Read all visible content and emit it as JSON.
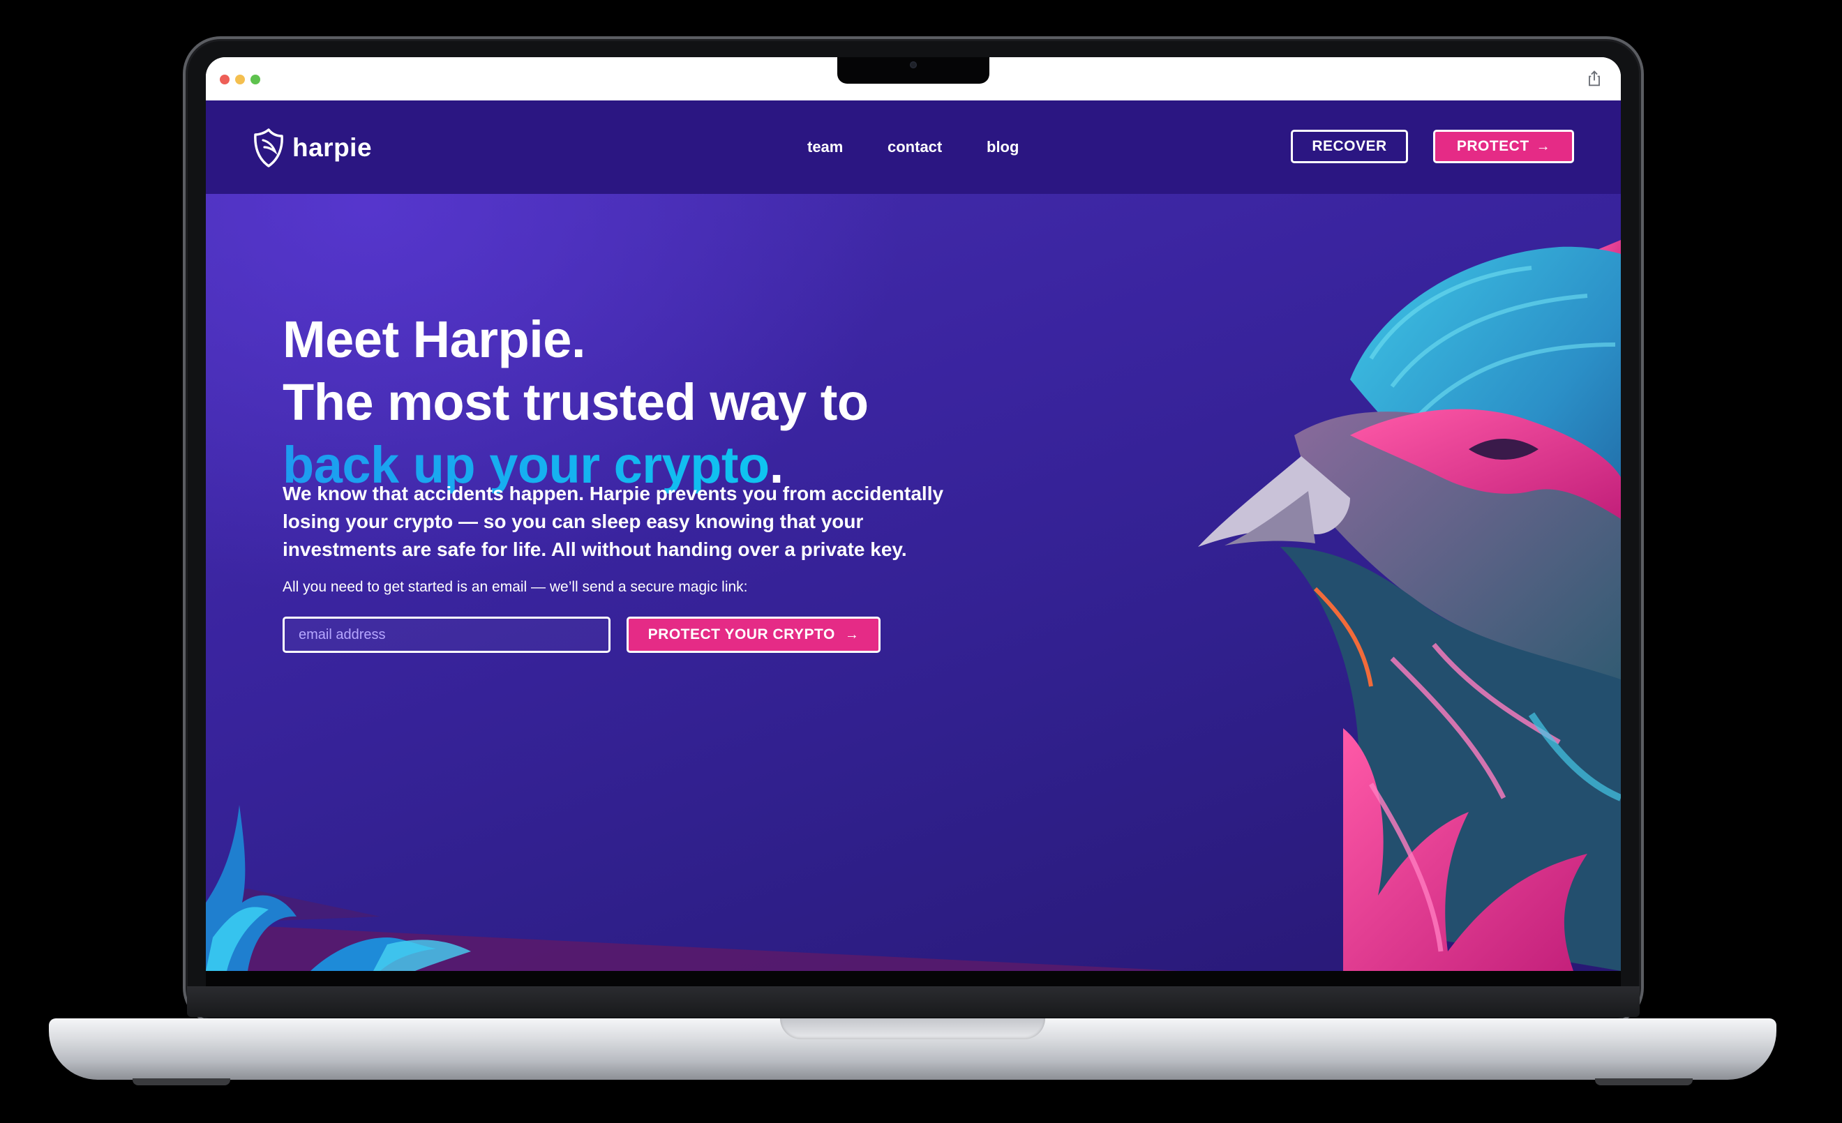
{
  "browser": {
    "traffic_lights": [
      "close",
      "minimize",
      "zoom"
    ],
    "share_icon": "share-icon"
  },
  "nav": {
    "logo_text": "harpie",
    "links": [
      "team",
      "contact",
      "blog"
    ],
    "recover_label": "RECOVER",
    "protect_label": "PROTECT"
  },
  "hero": {
    "title_line1": "Meet Harpie.",
    "title_line2": "The most trusted way to",
    "title_accent": "back up your crypto",
    "title_period": ".",
    "description_line1": "We know that accidents happen.  Harpie prevents you from accidentally",
    "description_line2": "losing your crypto — so you can sleep easy knowing that your",
    "description_line3": "investments are safe for life. All without handing over a private key.",
    "cta_label": "All you need to get started is an email — we’ll send a secure magic link:",
    "email_placeholder": "email address",
    "email_value": "",
    "cta_button_label": "PROTECT YOUR CRYPTO"
  },
  "colors": {
    "nav_bg": "#2b1682",
    "hero_bg": "#3a249f",
    "accent_pink": "#e52b86",
    "accent_blue": "#1e9bf0"
  }
}
